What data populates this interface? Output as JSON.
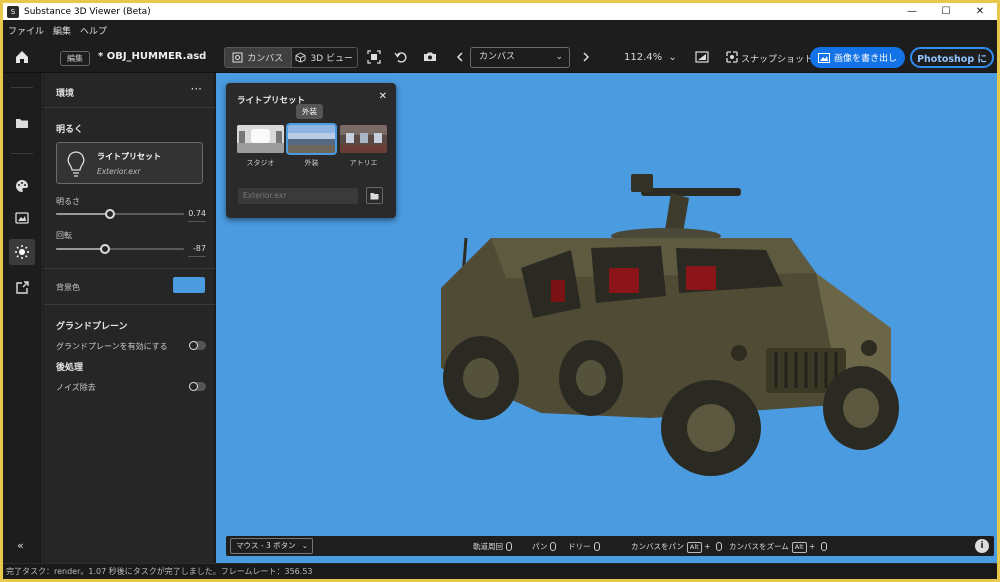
{
  "window": {
    "title": "Substance 3D Viewer (Beta)",
    "minimize": "—",
    "maximize": "☐",
    "close": "✕"
  },
  "menu": [
    "ファイル",
    "編集",
    "ヘルプ"
  ],
  "toolbar": {
    "edit_badge": "編集",
    "filename": "* OBJ_HUMMER.asd",
    "tab_canvas": "カンバス",
    "tab_3dview": "3D ビュー",
    "canvas_dropdown": "カンバス",
    "zoom": "112.4%",
    "snapshot": "スナップショット",
    "export_image": "画像を書き出し",
    "photoshop": "Photoshop に"
  },
  "panel": {
    "title": "環境",
    "more": "···",
    "section_lighting": "明るく",
    "preset_title": "ライトプリセット",
    "preset_file": "Exterior.exr",
    "brightness_label": "明るさ",
    "brightness_value": "0.74",
    "brightness_level": 0.42,
    "rotation_label": "回転",
    "rotation_value": "-87",
    "rotation_level": 0.38,
    "bg_color_label": "背景色",
    "bg_color": "#4a9be0",
    "section_ground": "グランドプレーン",
    "ground_enable_label": "グランドプレーンを有効にする",
    "ground_enabled": false,
    "section_post": "後処理",
    "denoise_label": "ノイズ除去",
    "denoise_enabled": false
  },
  "popup": {
    "title": "ライトプリセット",
    "tooltip": "外装",
    "presets": [
      {
        "label": "スタジオ",
        "selected": false
      },
      {
        "label": "外装",
        "selected": true
      },
      {
        "label": "アトリエ",
        "selected": false
      }
    ],
    "file_placeholder": "Exterior.exr"
  },
  "viewport": {
    "background": "#4a9be0",
    "mouse_mode": "マウス - 3 ボタン",
    "hint_orbit": "軌道周回",
    "hint_pan": "パン",
    "hint_dolly": "ドリー",
    "hint_canvas_pan": "カンバスをパン",
    "hint_canvas_zoom": "カンバスをズーム",
    "key_alt": "Alt",
    "info": "i"
  },
  "rail": {
    "collapse": "«"
  },
  "status": "完了タスク：render。1.07 秒後にタスクが完了しました。フレームレート：356.53",
  "colors": {
    "accent": "#1473e6",
    "frame_border": "#e6c94a"
  }
}
